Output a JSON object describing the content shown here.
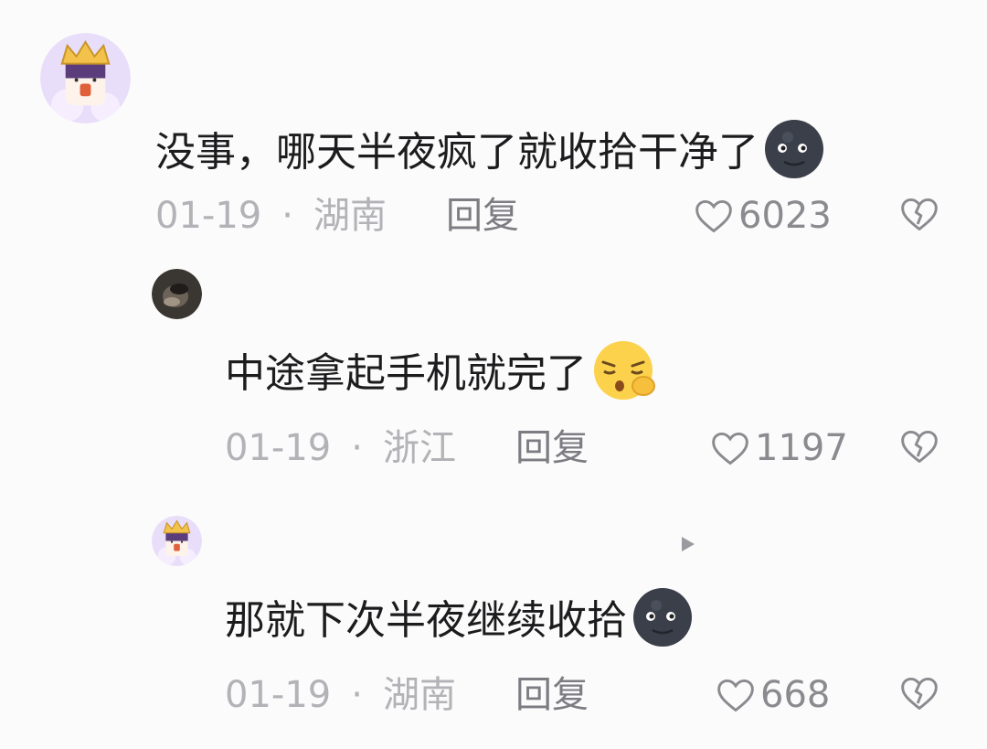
{
  "comments": [
    {
      "text": "没事，哪天半夜疯了就收拾干净了",
      "emoji": "new-moon-face-icon",
      "date": "01-19",
      "sep": "·",
      "location": "湖南",
      "reply": "回复",
      "likes": "6023"
    },
    {
      "text": "中途拿起手机就完了",
      "emoji": "sleepy-face-icon",
      "date": "01-19",
      "sep": "·",
      "location": "浙江",
      "reply": "回复",
      "likes": "1197"
    },
    {
      "text": "那就下次半夜继续收拾",
      "emoji": "new-moon-face-icon",
      "date": "01-19",
      "sep": "·",
      "location": "湖南",
      "reply": "回复",
      "likes": "668"
    }
  ]
}
